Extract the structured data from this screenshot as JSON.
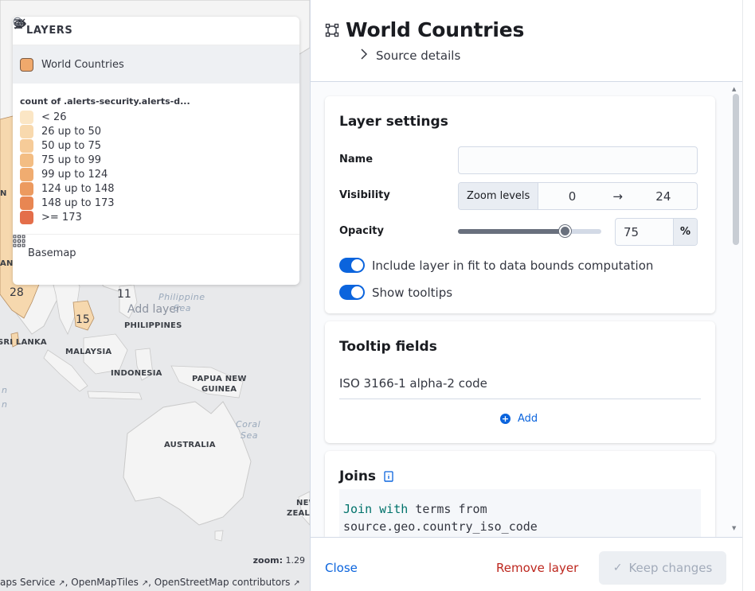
{
  "map": {
    "labels": {
      "philippines": "PHILIPPINES",
      "sri_lanka": "SRI LANKA",
      "malaysia": "MALAYSIA",
      "indonesia": "INDONESIA",
      "papua_line1": "PAPUA NEW",
      "papua_line2": "GUINEA",
      "australia": "AUSTRALIA",
      "nz_line1": "NEW",
      "nz_line2": "ZEALA",
      "edge_n": "N",
      "edge_an": "AN"
    },
    "seas": {
      "philippine_line1": "Philippine",
      "philippine_line2": "Sea",
      "coral_line1": "Coral",
      "coral_line2": "Sea",
      "indian_line1": "n",
      "indian_line2": "n"
    },
    "numbers": {
      "n28": "28",
      "n11": "11",
      "n15": "15"
    },
    "add_layer_ghost": "Add layer",
    "zoom_label": "zoom:",
    "zoom_value": "1.29",
    "attribution": {
      "part1": "aps Service",
      "part2": "OpenMapTiles",
      "part3": "OpenStreetMap contributors"
    }
  },
  "layers_panel": {
    "title": "LAYERS",
    "icons": [
      "eye-closed-icon",
      "eye-icon",
      "collapse-right-icon"
    ],
    "layer": {
      "name": "World Countries",
      "swatch_color": "#f0a96c",
      "time_icon": "clock-icon"
    },
    "legend": {
      "title": "count of .alerts-security.alerts-d...",
      "items": [
        {
          "label": "< 26",
          "color": "#fbe6c5"
        },
        {
          "label": "26 up to 50",
          "color": "#f8d9ae"
        },
        {
          "label": "50 up to 75",
          "color": "#f6cb98"
        },
        {
          "label": "75 up to 99",
          "color": "#f3bd83"
        },
        {
          "label": "99 up to 124",
          "color": "#f0ac70"
        },
        {
          "label": "124 up to 148",
          "color": "#ec9a5f"
        },
        {
          "label": "148 up to 173",
          "color": "#e88652"
        },
        {
          "label": ">= 173",
          "color": "#e46e4a"
        }
      ]
    },
    "basemap": {
      "name": "Basemap",
      "icon": "grid-icon"
    }
  },
  "editor": {
    "title": "World Countries",
    "title_icon": "vector-square-icon",
    "source_details": "Source details",
    "layer_settings": {
      "title": "Layer settings",
      "name_label": "Name",
      "name_value": "",
      "visibility_label": "Visibility",
      "zoom_prepend": "Zoom levels",
      "zoom_min": "0",
      "zoom_max": "24",
      "opacity_label": "Opacity",
      "opacity_value": "75",
      "opacity_fraction": 0.75,
      "opacity_unit": "%",
      "fit_bounds_label": "Include layer in fit to data bounds computation",
      "fit_bounds_on": true,
      "tooltips_label": "Show tooltips",
      "tooltips_on": true
    },
    "tooltip_fields": {
      "title": "Tooltip fields",
      "fields": [
        "ISO 3166-1 alpha-2 code"
      ],
      "add_label": "Add"
    },
    "joins": {
      "title": "Joins",
      "code_kw1": "Join",
      "code_kw2": "with",
      "code_rest1": "terms from",
      "code_line2": "source.geo.country_iso_code"
    },
    "footer": {
      "close": "Close",
      "remove": "Remove layer",
      "keep": "Keep changes"
    }
  },
  "colors": {
    "accent": "#0b64dd",
    "danger": "#bd271e",
    "land": "#f7f7f7",
    "sea": "#e8e9eb",
    "choropleth_land": "#f6d8ae"
  }
}
